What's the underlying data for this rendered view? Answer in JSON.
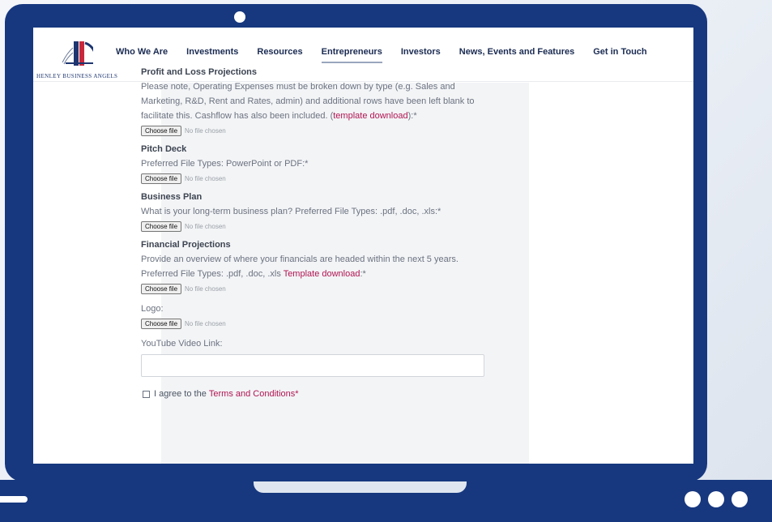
{
  "header": {
    "logo_text": "HENLEY BUSINESS ANGELS",
    "nav": [
      {
        "label": "Who We Are"
      },
      {
        "label": "Investments"
      },
      {
        "label": "Resources"
      },
      {
        "label": "Entrepreneurs",
        "active": true
      },
      {
        "label": "Investors"
      },
      {
        "label": "News, Events and Features"
      },
      {
        "label": "Get in Touch"
      }
    ]
  },
  "form": {
    "file_button_label": "Choose file",
    "file_status": "No file chosen",
    "profit_loss": {
      "title": "Profit and Loss Projections",
      "desc": "Please note, Operating Expenses must be broken down by type (e.g. Sales and Marketing, R&D, Rent and Rates, admin) and additional rows have been left blank to facilitate this. Cashflow has also been included. (",
      "link": "template download",
      "suffix": "):*"
    },
    "pitch_deck": {
      "title": "Pitch Deck",
      "desc": "Preferred File Types: PowerPoint or PDF:*"
    },
    "business_plan": {
      "title": "Business Plan",
      "desc": "What is your long-term business plan? Preferred File Types: .pdf, .doc, .xls:*"
    },
    "financial": {
      "title": "Financial Projections",
      "desc": "Provide an overview of where your financials are headed within the next 5 years. Preferred File Types: .pdf, .doc, .xls ",
      "link": "Template download",
      "suffix": ":*"
    },
    "logo_label": "Logo:",
    "youtube_label": "YouTube Video Link:",
    "youtube_value": "",
    "agree_prefix": "I agree to the ",
    "agree_link": "Terms and Conditions",
    "agree_suffix": "*"
  },
  "colors": {
    "frame": "#17387f",
    "link": "#b01552",
    "nav_text": "#1a2b52"
  }
}
